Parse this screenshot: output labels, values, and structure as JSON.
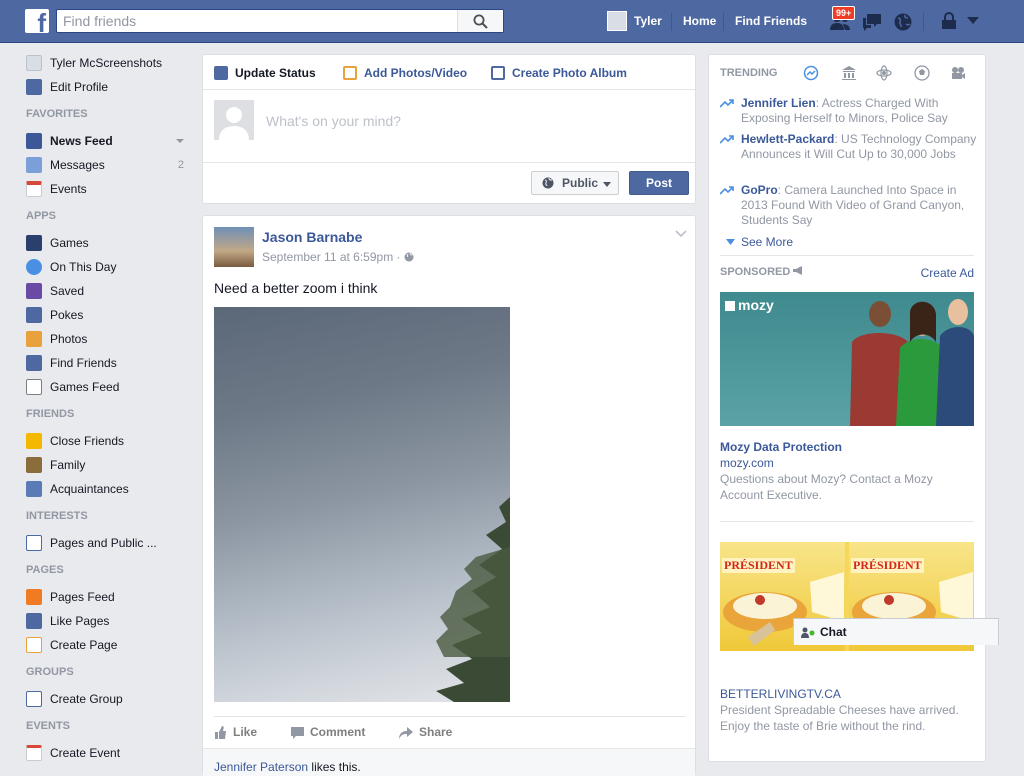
{
  "topbar": {
    "logo_letter": "f",
    "search_placeholder": "Find friends",
    "user_name": "Tyler",
    "home": "Home",
    "find_friends": "Find Friends",
    "friend_requests_badge": "99+"
  },
  "sidebar": {
    "profile_name": "Tyler McScreenshots",
    "edit_profile": "Edit Profile",
    "favorites_head": "FAVORITES",
    "news_feed": "News Feed",
    "messages": "Messages",
    "messages_count": "2",
    "events": "Events",
    "apps_head": "APPS",
    "games": "Games",
    "on_this_day": "On This Day",
    "saved": "Saved",
    "pokes": "Pokes",
    "photos": "Photos",
    "find_friends": "Find Friends",
    "games_feed": "Games Feed",
    "friends_head": "FRIENDS",
    "close_friends": "Close Friends",
    "family": "Family",
    "acquaintances": "Acquaintances",
    "interests_head": "INTERESTS",
    "pages_public": "Pages and Public ...",
    "pages_head": "PAGES",
    "pages_feed": "Pages Feed",
    "like_pages": "Like Pages",
    "create_page": "Create Page",
    "groups_head": "GROUPS",
    "create_group": "Create Group",
    "events_head": "EVENTS",
    "create_event": "Create Event"
  },
  "composer": {
    "tab_status": "Update Status",
    "tab_photos": "Add Photos/Video",
    "tab_album": "Create Photo Album",
    "placeholder": "What's on your mind?",
    "privacy": "Public",
    "post": "Post"
  },
  "post": {
    "author": "Jason Barnabe",
    "time": "September 11 at 6:59pm · ",
    "text": "Need a better zoom i think",
    "like": "Like",
    "comment": "Comment",
    "share": "Share",
    "liker": "Jennifer Paterson",
    "likes_suffix": " likes this."
  },
  "trending": {
    "head": "TRENDING",
    "items": [
      {
        "name": "Jennifer Lien",
        "text": ": Actress Charged With Exposing Herself to Minors, Police Say"
      },
      {
        "name": "Hewlett-Packard",
        "text": ": US Technology Company Announces it Will Cut Up to 30,000 Jobs"
      },
      {
        "name": "GoPro",
        "text": ": Camera Launched Into Space in 2013 Found With Video of Grand Canyon, Students Say"
      }
    ],
    "see_more": "See More"
  },
  "sponsored": {
    "head": "SPONSORED",
    "create_ad": "Create Ad",
    "ad1_logo": "mozy",
    "ad1_title": "Mozy Data Protection",
    "ad1_url": "mozy.com",
    "ad1_desc": "Questions about Mozy? Contact a Mozy Account Executive.",
    "ad2_brand": "PRÉSIDENT",
    "ad2_url": "BETTERLIVINGTV.CA",
    "ad2_desc": "President Spreadable Cheeses have arrived. Enjoy the taste of Brie without the rind."
  },
  "chat": {
    "label": "Chat"
  }
}
